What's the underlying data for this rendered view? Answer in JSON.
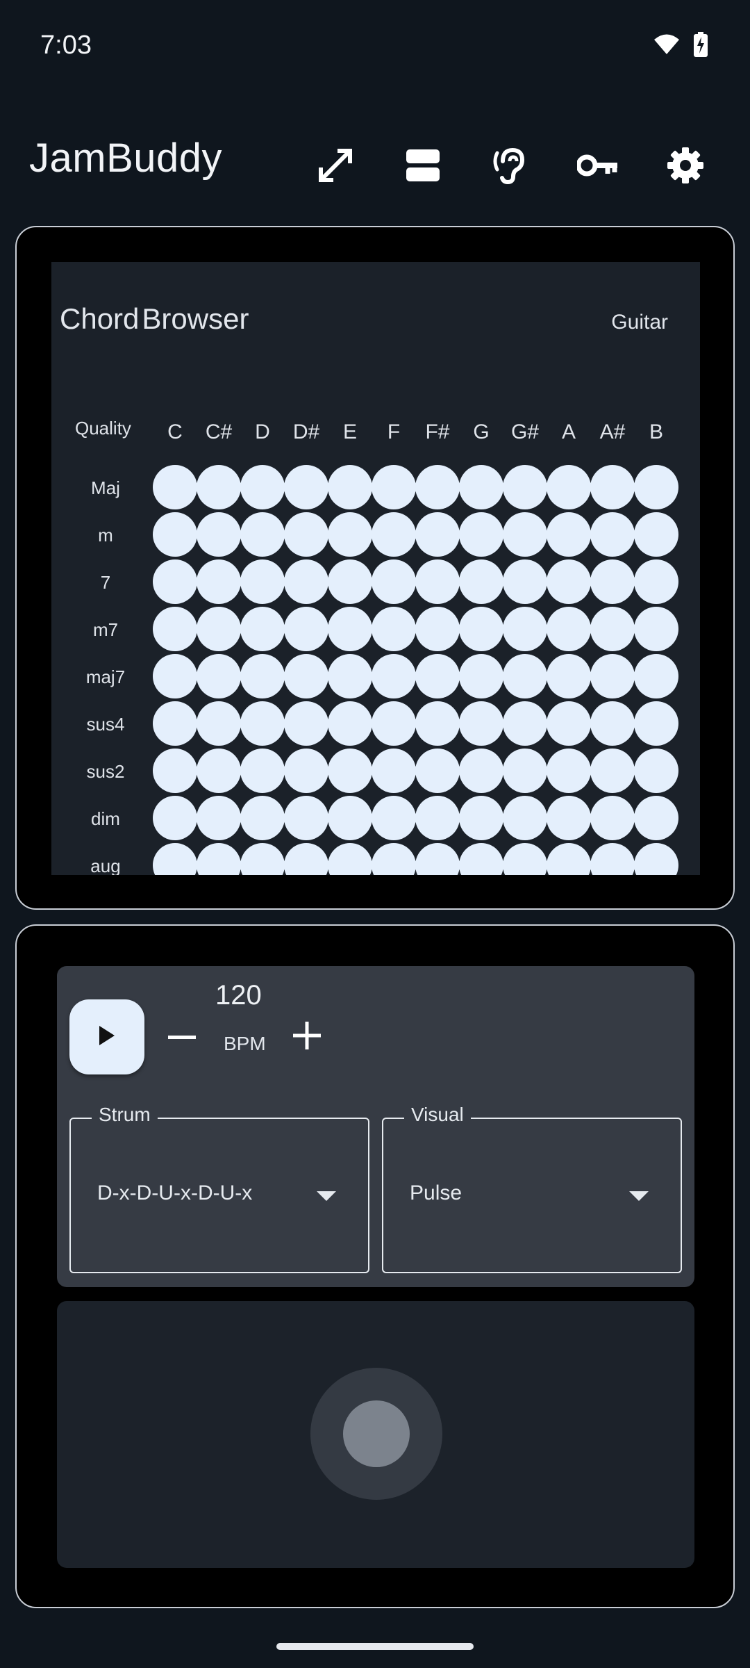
{
  "status": {
    "time": "7:03",
    "icons": [
      "wifi-icon",
      "battery-charging-icon"
    ]
  },
  "app": {
    "title": "JamBuddy",
    "actions": [
      "fullscreen-icon",
      "layout-split-icon",
      "ear-icon",
      "key-icon",
      "gear-icon"
    ]
  },
  "chord_browser": {
    "title_word1": "Chord",
    "title_word2": "Browser",
    "instrument": "Guitar",
    "quality_header": "Quality",
    "roots": [
      "C",
      "C#",
      "D",
      "D#",
      "E",
      "F",
      "F#",
      "G",
      "G#",
      "A",
      "A#",
      "B"
    ],
    "qualities": [
      "Maj",
      "m",
      "7",
      "m7",
      "maj7",
      "sus4",
      "sus2",
      "dim",
      "aug"
    ]
  },
  "metronome": {
    "bpm_value": "120",
    "bpm_label": "BPM",
    "strum_label": "Strum",
    "strum_value": "D-x-D-U-x-D-U-x",
    "visual_label": "Visual",
    "visual_value": "Pulse"
  },
  "colors": {
    "background": "#0f161e",
    "card": "#1b2129",
    "cell": "#e4effc",
    "controls": "#363b44"
  }
}
